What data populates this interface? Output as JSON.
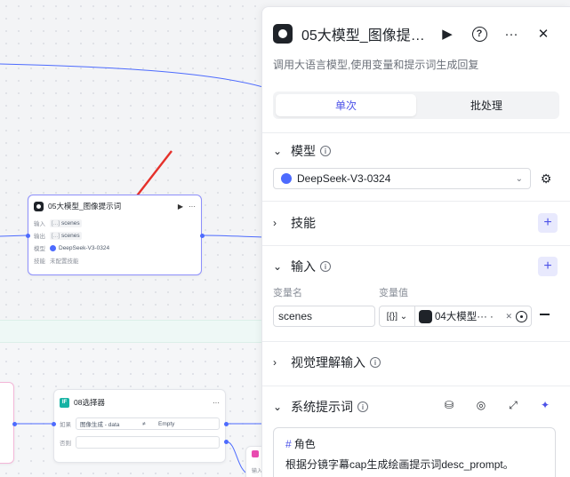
{
  "canvas": {
    "node_llm": {
      "title": "05大模型_图像提示词",
      "run_icon": "▶",
      "more_icon": "···",
      "rows": [
        {
          "key": "输入",
          "type_badge": "[...]",
          "value": "scenes"
        },
        {
          "key": "输出",
          "type_badge": "[...]",
          "value": "scenes"
        },
        {
          "key": "模型",
          "type_badge": "",
          "value": "DeepSeek-V3-0324"
        },
        {
          "key": "技能",
          "type_badge": "",
          "value": "未配置技能"
        }
      ]
    },
    "node_selector": {
      "icon_text": "IF",
      "title": "08选择器",
      "more_icon": "···",
      "rows": [
        {
          "key": "如果",
          "left": "图像生成 - data",
          "op": "≠",
          "right": "Empty"
        },
        {
          "key": "否则",
          "left": "",
          "op": "",
          "right": ""
        }
      ]
    },
    "partial_node_label": "输入"
  },
  "panel": {
    "title": "05大模型_图像提…",
    "description": "调用大语言模型,使用变量和提示词生成回复",
    "header_icons": {
      "run": "▶",
      "help": "?",
      "more": "···",
      "close": "✕"
    },
    "tabs": [
      {
        "label": "单次",
        "active": true
      },
      {
        "label": "批处理",
        "active": false
      }
    ],
    "sections": {
      "model": {
        "title": "模型",
        "selected": "DeepSeek-V3-0324"
      },
      "skills": {
        "title": "技能"
      },
      "input": {
        "title": "输入",
        "col_name": "变量名",
        "col_value": "变量值",
        "rows": [
          {
            "name": "scenes",
            "type": "[{}]",
            "ref": "04大模型··· ·"
          }
        ]
      },
      "visual": {
        "title": "视觉理解输入"
      },
      "system_prompt": {
        "title": "系统提示词",
        "heading": "角色",
        "heading_hash": "#",
        "body": "根据分镜字幕cap生成绘画提示词desc_prompt。"
      }
    }
  },
  "colors": {
    "accent": "#4d53e8",
    "wire": "#4d6bfe",
    "arrow": "#e5312b",
    "selector_teal": "#16b3a4"
  }
}
